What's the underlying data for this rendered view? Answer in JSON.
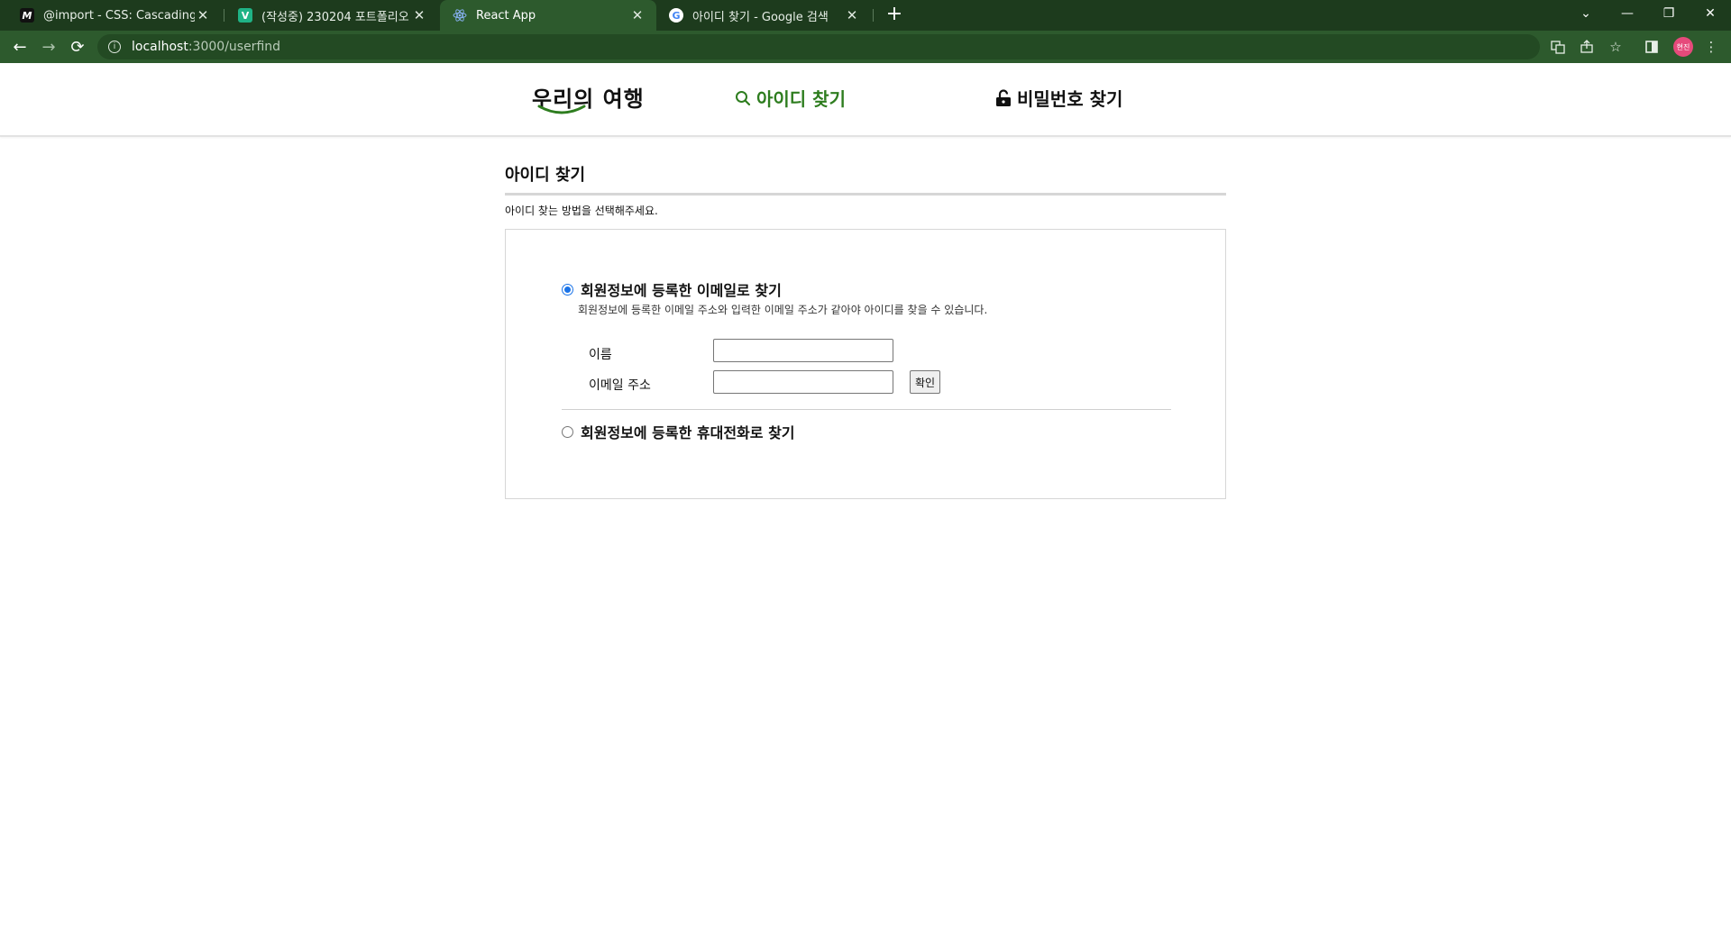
{
  "browser": {
    "tabs": [
      {
        "favicon": "M",
        "title": "@import - CSS: Cascading Style",
        "active": false
      },
      {
        "favicon": "V",
        "title": "(작성중) 230204 포트폴리오 프로",
        "active": false
      },
      {
        "favicon": "react-icon",
        "title": "React App",
        "active": true
      },
      {
        "favicon": "G",
        "title": "아이디 찾기 - Google 검색",
        "active": false
      }
    ],
    "new_tab": "+",
    "url_host": "localhost",
    "url_path": ":3000/userfind",
    "profile_initials": "현진",
    "accent_color": "#2d5a2d"
  },
  "header": {
    "logo_text": "우리의 여행",
    "nav": [
      {
        "label": "아이디 찾기",
        "icon": "search-icon",
        "current": true
      },
      {
        "label": "비밀번호 찾기",
        "icon": "unlock-icon",
        "current": false
      }
    ],
    "accent_color": "#2e7d1f"
  },
  "main": {
    "title": "아이디 찾기",
    "subtitle": "아이디 찾는 방법을 선택해주세요.",
    "options": [
      {
        "label": "회원정보에 등록한 이메일로 찾기",
        "selected": true,
        "description": "회원정보에 등록한 이메일 주소와 입력한 이메일 주소가 같아야 아이디를 찾을 수 있습니다.",
        "fields": [
          {
            "label": "이름",
            "value": ""
          },
          {
            "label": "이메일 주소",
            "value": ""
          }
        ],
        "confirm_label": "확인"
      },
      {
        "label": "회원정보에 등록한 휴대전화로 찾기",
        "selected": false
      }
    ]
  }
}
